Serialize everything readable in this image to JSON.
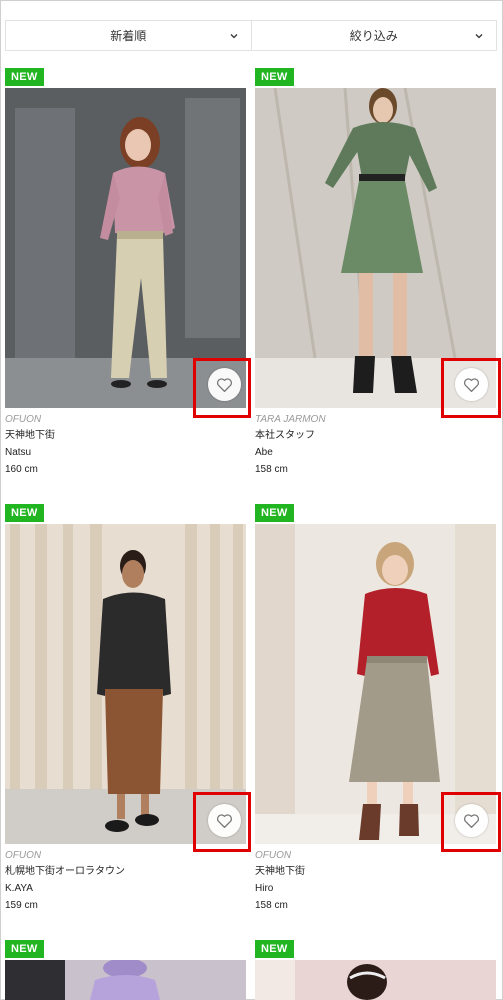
{
  "toolbar": {
    "sort_label": "新着順",
    "filter_label": "絞り込み"
  },
  "cards": [
    {
      "badge": "NEW",
      "brand": "OFUON",
      "shop": "天神地下街",
      "staff": "Natsu",
      "height": "160 cm"
    },
    {
      "badge": "NEW",
      "brand": "TARA JARMON",
      "shop": "本社スタッフ",
      "staff": "Abe",
      "height": "158 cm"
    },
    {
      "badge": "NEW",
      "brand": "OFUON",
      "shop": "札幌地下街オーロラタウン",
      "staff": "K.AYA",
      "height": "159 cm"
    },
    {
      "badge": "NEW",
      "brand": "OFUON",
      "shop": "天神地下街",
      "staff": "Hiro",
      "height": "158 cm"
    },
    {
      "badge": "NEW"
    },
    {
      "badge": "NEW"
    }
  ],
  "icons": {
    "favorite": "heart-outline-icon",
    "dropdown": "chevron-down-icon"
  },
  "colors": {
    "badge": "#22b522",
    "highlight": "#e00000"
  }
}
